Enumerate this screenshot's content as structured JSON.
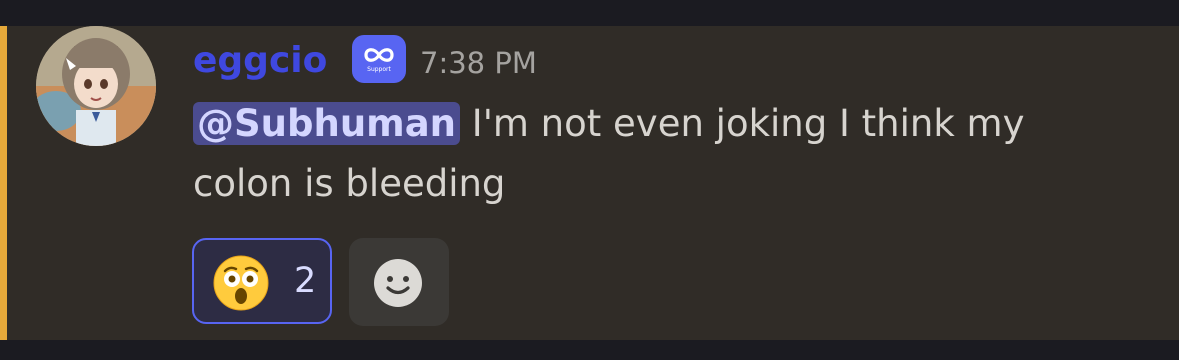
{
  "message": {
    "author": "eggcio",
    "badge_label": "Support",
    "badge_icon": "infinity-icon",
    "timestamp": "7:38 PM",
    "mention": "@Subhuman",
    "text": " I'm not even joking I think my colon is bleeding",
    "colors": {
      "username": "#3f48e0",
      "mention_bar": "#e6a93a",
      "badge_bg": "#5865f2"
    }
  },
  "reactions": [
    {
      "emoji_icon": "astonished-face-icon",
      "count": "2",
      "active": true
    }
  ],
  "add_reaction": {
    "icon": "smiley-face-icon"
  }
}
